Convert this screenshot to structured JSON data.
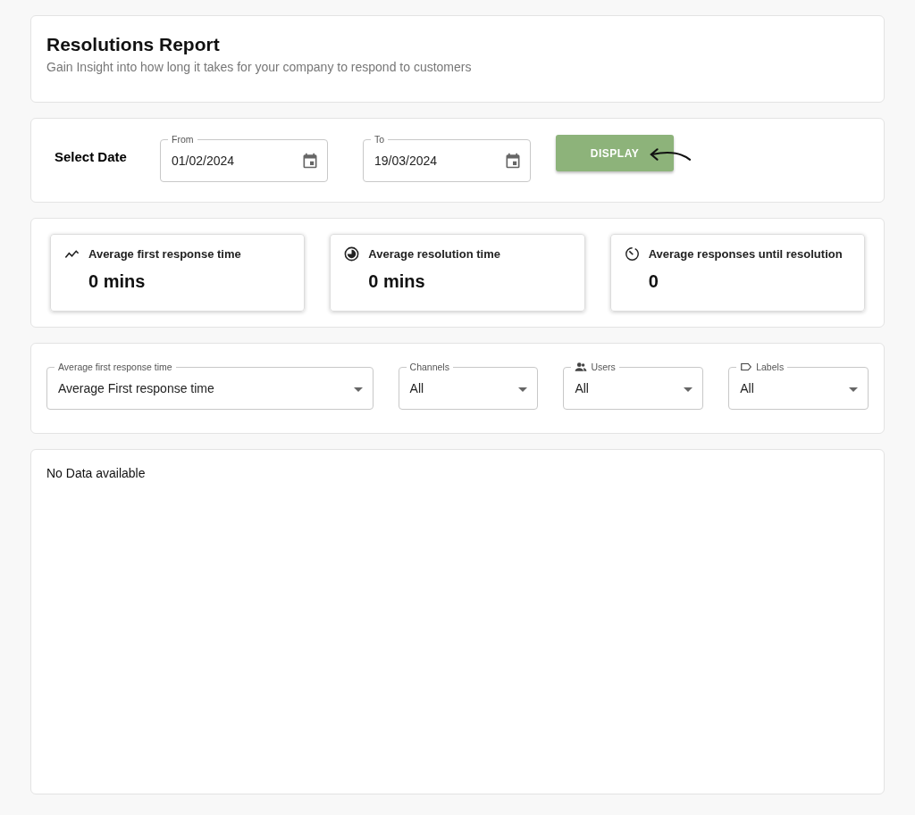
{
  "header": {
    "title": "Resolutions Report",
    "subtitle": "Gain Insight into how long it takes for your company to respond to customers"
  },
  "date_filter": {
    "label": "Select Date",
    "fields": [
      {
        "label": "From",
        "value": "01/02/2024"
      },
      {
        "label": "To",
        "value": "19/03/2024"
      }
    ],
    "button": "DISPLAY"
  },
  "stats": [
    {
      "label": "Average first response time",
      "value": "0 mins"
    },
    {
      "label": "Average resolution time",
      "value": "0 mins"
    },
    {
      "label": "Average responses until resolution",
      "value": "0"
    }
  ],
  "filters": [
    {
      "label": "Average first response time",
      "value": "Average First response time"
    },
    {
      "label": "Channels",
      "value": "All"
    },
    {
      "label": "Users",
      "value": "All"
    },
    {
      "label": "Labels",
      "value": "All"
    }
  ],
  "chart_panel": {
    "message": "No Data available"
  }
}
